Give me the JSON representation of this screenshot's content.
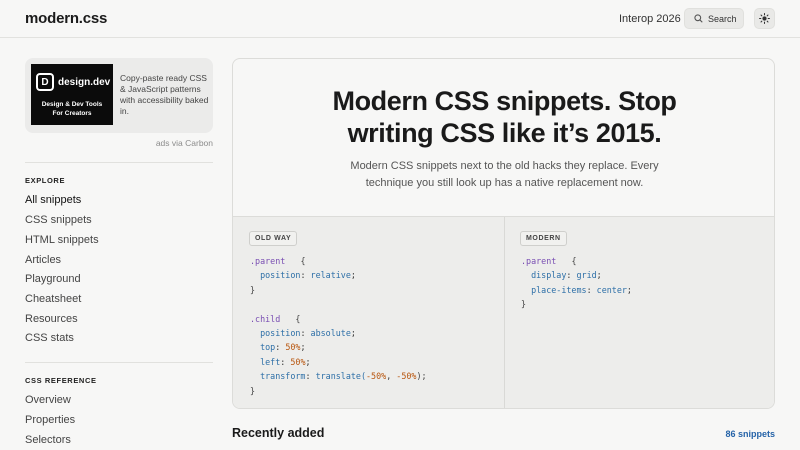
{
  "header": {
    "logo": "modern.css",
    "interop": "Interop 2026",
    "search_label": "Search",
    "theme_icon": "sun-icon",
    "search_icon": "search-icon"
  },
  "ad": {
    "brand": "design.dev",
    "brand_mark": "D",
    "tagline_1": "Design & Dev Tools",
    "tagline_2": "For Creators",
    "text": "Copy-paste ready CSS & JavaScript patterns with accessibility baked in.",
    "via": "ads via Carbon"
  },
  "sidebar": {
    "explore_title": "EXPLORE",
    "explore": [
      {
        "label": "All snippets",
        "active": true
      },
      {
        "label": "CSS snippets"
      },
      {
        "label": "HTML snippets"
      },
      {
        "label": "Articles"
      },
      {
        "label": "Playground"
      },
      {
        "label": "Cheatsheet"
      },
      {
        "label": "Resources"
      },
      {
        "label": "CSS stats"
      }
    ],
    "reference_title": "CSS REFERENCE",
    "reference": [
      {
        "label": "Overview"
      },
      {
        "label": "Properties"
      },
      {
        "label": "Selectors"
      }
    ]
  },
  "hero": {
    "title_line1": "Modern CSS snippets. Stop",
    "title_line2": "writing CSS like it’s 2015.",
    "sub_line1": "Modern CSS snippets next to the old hacks they replace. Every",
    "sub_line2": "technique you still look up has a native replacement now."
  },
  "compare": {
    "old_label": "OLD WAY",
    "modern_label": "MODERN",
    "old_code": {
      "l1_sel": ".parent",
      "l1_brace": "{",
      "l2_prop": "position",
      "l2_val": "relative",
      "l3": "}",
      "l5_sel": ".child",
      "l5_brace": "{",
      "l6_prop": "position",
      "l6_val": "absolute",
      "l7_prop": "top",
      "l7_num": "50",
      "l7_unit": "%",
      "l8_prop": "left",
      "l8_num": "50",
      "l8_unit": "%",
      "l9_prop": "transform",
      "l9_fn": "translate(",
      "l9_n1": "-50",
      "l9_u1": "%",
      "l9_sep": ", ",
      "l9_n2": "-50",
      "l9_u2": "%",
      "l9_end": ");",
      "l10": "}"
    },
    "modern_code": {
      "l1_sel": ".parent",
      "l1_brace": "{",
      "l2_prop": "display",
      "l2_val": "grid",
      "l3_prop": "place-items",
      "l3_val": "center",
      "l4": "}"
    }
  },
  "recent": {
    "title": "Recently added",
    "count": "86 snippets"
  },
  "colors": {
    "background": "#f7f7f6",
    "accent_link": "#2563a8",
    "selector": "#7a4fb3",
    "number": "#b8560f"
  }
}
